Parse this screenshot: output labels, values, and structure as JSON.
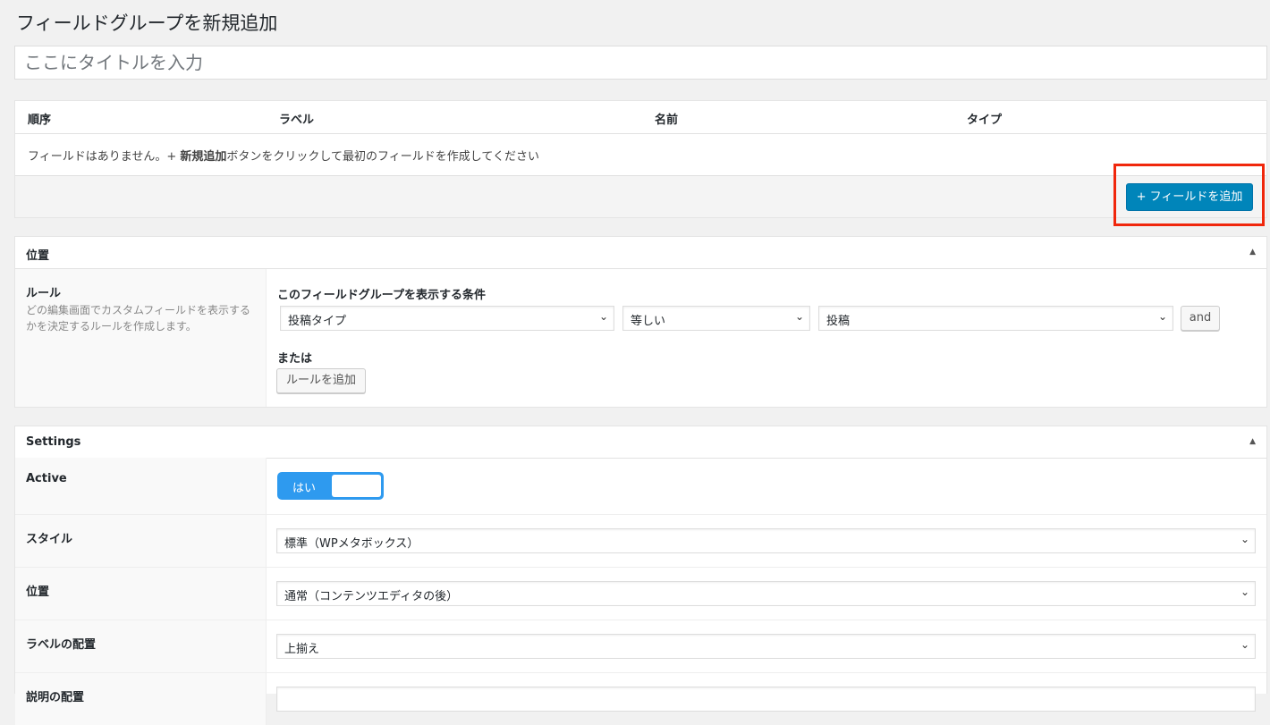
{
  "page_title": "フィールドグループを新規追加",
  "title_input": {
    "placeholder": "ここにタイトルを入力",
    "value": ""
  },
  "fields": {
    "columns": [
      "順序",
      "ラベル",
      "名前",
      "タイプ"
    ],
    "empty_message_pre": "フィールドはありません。+ ",
    "empty_message_bold": "新規追加",
    "empty_message_post": "ボタンをクリックして最初のフィールドを作成してください",
    "add_button": "+ フィールドを追加",
    "highlight_color": "#f0270c",
    "button_color": "#0085ba"
  },
  "location": {
    "title": "位置",
    "rule_label": "ルール",
    "rule_desc": "どの編集画面でカスタムフィールドを表示するかを決定するルールを作成します。",
    "condition_heading": "このフィールドグループを表示する条件",
    "param": "投稿タイプ",
    "operator": "等しい",
    "value": "投稿",
    "and_button": "and",
    "or_label": "または",
    "add_rule_button": "ルールを追加"
  },
  "settings": {
    "title": "Settings",
    "active_label": "Active",
    "active_toggle": "はい",
    "active_on": true,
    "toggle_color": "#2e9aef",
    "rows": [
      {
        "label": "スタイル",
        "value": "標準（WPメタボックス）"
      },
      {
        "label": "位置",
        "value": "通常（コンテンツエディタの後）"
      },
      {
        "label": "ラベルの配置",
        "value": "上揃え"
      },
      {
        "label": "説明の配置",
        "value": ""
      }
    ]
  }
}
